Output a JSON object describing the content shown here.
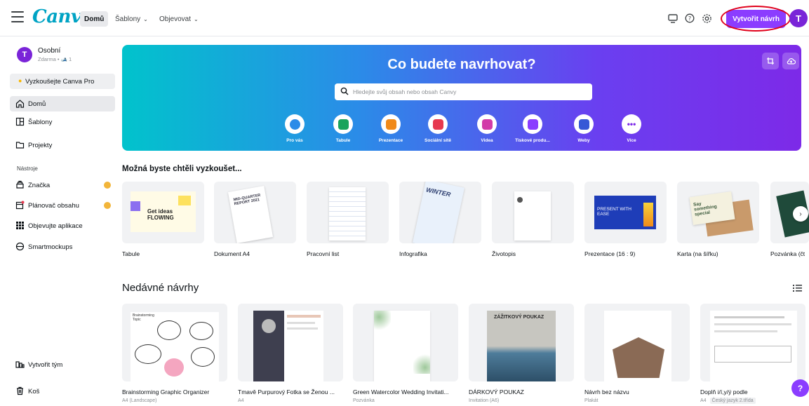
{
  "topbar": {
    "logo": "Canva",
    "nav": [
      {
        "label": "Domů"
      },
      {
        "label": "Šablony"
      },
      {
        "label": "Objevovat"
      }
    ],
    "create_label": "Vytvořit návrh",
    "avatar_letter": "T"
  },
  "sidebar": {
    "account_letter": "T",
    "account_name": "Osobní",
    "account_plan": "Zdarma • 🎿 1",
    "try_pro": "Vyzkoušejte Canva Pro",
    "items": [
      {
        "label": "Domů"
      },
      {
        "label": "Šablony"
      },
      {
        "label": "Projekty"
      }
    ],
    "tools_heading": "Nástroje",
    "tools": [
      {
        "label": "Značka"
      },
      {
        "label": "Plánovač obsahu"
      },
      {
        "label": "Objevujte aplikace"
      },
      {
        "label": "Smartmockups"
      }
    ],
    "create_team": "Vytvořit tým",
    "trash": "Koš"
  },
  "hero": {
    "title": "Co budete navrhovat?",
    "search_placeholder": "Hledejte svůj obsah nebo obsah Canvy",
    "categories": [
      {
        "label": "Pro vás",
        "color": "#2b8be8"
      },
      {
        "label": "Tabule",
        "color": "#1aa35c"
      },
      {
        "label": "Prezentace",
        "color": "#f08a1b"
      },
      {
        "label": "Sociální sítě",
        "color": "#e6384f"
      },
      {
        "label": "Videa",
        "color": "#d23ba8"
      },
      {
        "label": "Tiskové produ...",
        "color": "#8b3dff"
      },
      {
        "label": "Weby",
        "color": "#3658d6"
      },
      {
        "label": "Více",
        "color": "#7d2ae8"
      }
    ]
  },
  "suggestions": {
    "title": "Možná byste chtěli vyzkoušet...",
    "items": [
      {
        "label": "Tabule",
        "thumb_text": "Get ideas FLOWING"
      },
      {
        "label": "Dokument A4",
        "thumb_text": "MID-QUARTER REPORT 2021"
      },
      {
        "label": "Pracovní list",
        "thumb_text": ""
      },
      {
        "label": "Infografika",
        "thumb_text": "WINTER"
      },
      {
        "label": "Životopis",
        "thumb_text": ""
      },
      {
        "label": "Prezentace (16 : 9)",
        "thumb_text": "PRESENT WITH EASE"
      },
      {
        "label": "Karta (na šířku)",
        "thumb_text": "Say something special"
      },
      {
        "label": "Pozvánka (čt",
        "thumb_text": ""
      }
    ]
  },
  "recent": {
    "title": "Nedávné návrhy",
    "items": [
      {
        "title": "Brainstorming Graphic Organizer",
        "sub": "A4 (Landscape)",
        "thumb_text": "Brainstorming Topic"
      },
      {
        "title": "Tmavě Purpurový Fotka se Ženou ...",
        "sub": "A4",
        "thumb_text": ""
      },
      {
        "title": "Green Watercolor Wedding Invitati...",
        "sub": "Pozvánka",
        "thumb_text": ""
      },
      {
        "title": "DÁRKOVÝ POUKAZ",
        "sub": "Invitation (A6)",
        "thumb_text": "ZÁŽITKOVÝ POUKAZ"
      },
      {
        "title": "Návrh bez názvu",
        "sub": "Plakát",
        "thumb_text": ""
      },
      {
        "title": "Doplň i/í,y/ý podle",
        "sub": "A4",
        "tag": "Český jazyk 2.třída",
        "thumb_text": ""
      }
    ]
  },
  "help_label": "?"
}
